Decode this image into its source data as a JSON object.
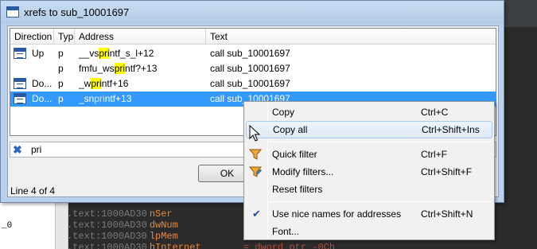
{
  "background": {
    "left_pane_text": "_0",
    "code_lines": [
      {
        "addr": ".text:1000AD30",
        "name": "nSer",
        "rest": ""
      },
      {
        "addr": ".text:1000AD30",
        "name": "dwNum",
        "rest": ""
      },
      {
        "addr": ".text:1000AD30",
        "name": "lpMem",
        "rest": ""
      },
      {
        "addr": ".text:1000AD30",
        "name": "hInternet",
        "rest": "= dword ptr -0Ch"
      }
    ]
  },
  "dialog": {
    "title": "xrefs to sub_10001697",
    "columns": {
      "direction": "Direction",
      "type": "Typ",
      "address": "Address",
      "text": "Text"
    },
    "rows": [
      {
        "direction": "Up",
        "type": "p",
        "addr_pre": "__vs",
        "addr_hl": "pri",
        "addr_post": "ntf_s_l+12",
        "text": "call    sub_10001697"
      },
      {
        "direction": "",
        "type": "p",
        "addr_pre": "fmfu_ws",
        "addr_hl": "pri",
        "addr_post": "ntf?+13",
        "text": "call    sub_10001697"
      },
      {
        "direction": "Do...",
        "type": "p",
        "addr_pre": "_w",
        "addr_hl": "pri",
        "addr_post": "ntf+16",
        "text": "call    sub_10001697"
      },
      {
        "direction": "Do...",
        "type": "p",
        "addr_pre": "_sn",
        "addr_hl": "pri",
        "addr_post": "ntf+13",
        "text": "call    sub_10001697"
      }
    ],
    "filter_value": "pri",
    "ok_label": "OK",
    "status": "Line 4 of 4"
  },
  "menu": {
    "items": [
      {
        "label": "Copy",
        "shortcut": "Ctrl+C"
      },
      {
        "label": "Copy all",
        "shortcut": "Ctrl+Shift+Ins"
      },
      {
        "label": "Quick filter",
        "shortcut": "Ctrl+F"
      },
      {
        "label": "Modify filters...",
        "shortcut": "Ctrl+Shift+F"
      },
      {
        "label": "Reset filters",
        "shortcut": ""
      },
      {
        "label": "Use nice names for addresses",
        "shortcut": "Ctrl+Shift+N"
      },
      {
        "label": "Font...",
        "shortcut": ""
      }
    ],
    "checked_item": "Use nice names for addresses"
  },
  "colors": {
    "selection": "#3399ff",
    "highlight": "#ffff00",
    "titlebar": "#b9d1ea"
  }
}
